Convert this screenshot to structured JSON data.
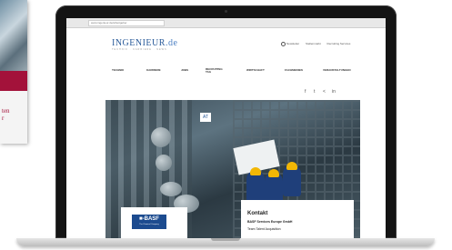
{
  "background_card": {
    "text_line1": "ten",
    "text_line2": "r"
  },
  "browser": {
    "url": "www.ingenieur.de/arbeitgeber"
  },
  "site": {
    "logo_text": "INGENIEUR",
    "logo_suffix": ".de",
    "tagline": "TECHNIK · KARRIERE · NEWS",
    "top_links": [
      "Newsletter",
      "Stellenmarkt",
      "Recruiting Services"
    ],
    "nav": [
      "TECHNIK",
      "KARRIERE",
      "JOBS",
      "RECRUITING TAG",
      "WIRTSCHAFT",
      "FACHMEDIEN",
      "VERANSTALTUNGEN"
    ],
    "social_icons": [
      "facebook-icon",
      "twitter-icon",
      "share-icon",
      "linkedin-icon"
    ],
    "social_glyphs": [
      "f",
      "t",
      "<",
      "in"
    ]
  },
  "hero": {
    "badge": "AT"
  },
  "employer": {
    "logo_text": "■-BASF",
    "logo_sub": "The Chemical Company"
  },
  "kontakt": {
    "title": "Kontakt",
    "company": "BASF Services Europe GmbH",
    "team": "Team Talent Acquisition"
  },
  "colors": {
    "brand_blue": "#2a5b9a",
    "basf_blue": "#1c4b8f",
    "card_red": "#a3123a",
    "helmet_yellow": "#f2b705"
  }
}
